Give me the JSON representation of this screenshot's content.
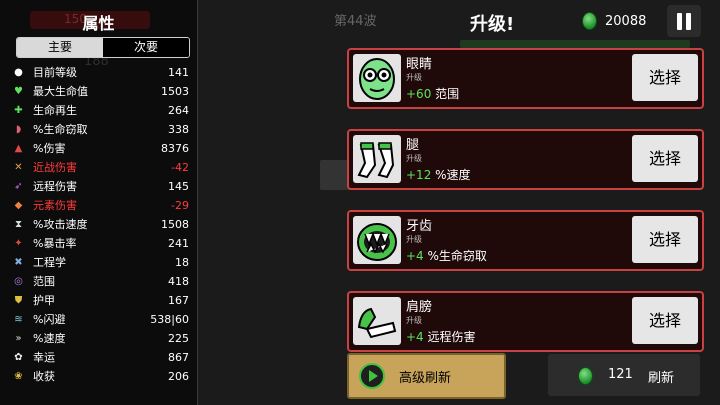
{
  "left_panel": {
    "ghost_hp": "150",
    "title": "属性",
    "ghost_number": "188",
    "tabs": [
      {
        "label": "主要",
        "active": true
      },
      {
        "label": "次要",
        "active": false
      }
    ],
    "stats": [
      {
        "icon": "level-icon",
        "color": "#ffffff",
        "label": "目前等级",
        "value": "141",
        "negative": false
      },
      {
        "icon": "heart-icon",
        "color": "#5ee15e",
        "label": "最大生命值",
        "value": "1503",
        "negative": false
      },
      {
        "icon": "regen-icon",
        "color": "#5ee15e",
        "label": "生命再生",
        "value": "264",
        "negative": false
      },
      {
        "icon": "lifesteal-icon",
        "color": "#e0607a",
        "label": "%生命窃取",
        "value": "338",
        "negative": false
      },
      {
        "icon": "damage-icon",
        "color": "#e04848",
        "label": "%伤害",
        "value": "8376",
        "negative": false
      },
      {
        "icon": "melee-icon",
        "color": "#e0a050",
        "label": "近战伤害",
        "value": "-42",
        "negative": true
      },
      {
        "icon": "ranged-icon",
        "color": "#c070e0",
        "label": "远程伤害",
        "value": "145",
        "negative": false
      },
      {
        "icon": "elemental-icon",
        "color": "#f08040",
        "label": "元素伤害",
        "value": "-29",
        "negative": true
      },
      {
        "icon": "attack-speed-icon",
        "color": "#dddddd",
        "label": "%攻击速度",
        "value": "1508",
        "negative": false
      },
      {
        "icon": "crit-icon",
        "color": "#e04848",
        "label": "%暴击率",
        "value": "241",
        "negative": false
      },
      {
        "icon": "engineering-icon",
        "color": "#80b0e0",
        "label": "工程学",
        "value": "18",
        "negative": false
      },
      {
        "icon": "range-icon",
        "color": "#b080e0",
        "label": "范围",
        "value": "418",
        "negative": false
      },
      {
        "icon": "armor-icon",
        "color": "#e0c040",
        "label": "护甲",
        "value": "167",
        "negative": false
      },
      {
        "icon": "dodge-icon",
        "color": "#80d0e0",
        "label": "%闪避",
        "value": "538|60",
        "negative": false
      },
      {
        "icon": "speed-icon",
        "color": "#dddddd",
        "label": "%速度",
        "value": "225",
        "negative": false
      },
      {
        "icon": "luck-icon",
        "color": "#eeeeee",
        "label": "幸运",
        "value": "867",
        "negative": false
      },
      {
        "icon": "harvest-icon",
        "color": "#e0c040",
        "label": "收获",
        "value": "206",
        "negative": false
      }
    ]
  },
  "header": {
    "wave": "第44波",
    "title": "升级!",
    "currency_amount": "20088",
    "currency_icon": "green-material-icon",
    "pause_icon": "pause-icon"
  },
  "upgrades": [
    {
      "name": "眼睛",
      "sub": "升级",
      "effect_value": "+60",
      "effect_label": "范围",
      "button": "选择",
      "icon": "alien-eyes-icon"
    },
    {
      "name": "腿",
      "sub": "升级",
      "effect_value": "+12",
      "effect_label": "%速度",
      "button": "选择",
      "icon": "legs-icon"
    },
    {
      "name": "牙齿",
      "sub": "升级",
      "effect_value": "+4",
      "effect_label": "%生命窃取",
      "button": "选择",
      "icon": "teeth-icon"
    },
    {
      "name": "肩膀",
      "sub": "升级",
      "effect_value": "+4",
      "effect_label": "远程伤害",
      "button": "选择",
      "icon": "shoulders-icon"
    }
  ],
  "footer": {
    "advanced_refresh": "高级刷新",
    "refresh_cost": "121",
    "refresh_label": "刷新"
  },
  "colors": {
    "card_border": "#c94141",
    "card_bg": "#200909",
    "positive": "#5ee15e",
    "negative": "#ff3b3b",
    "advanced_refresh_bg": "#c8a45a"
  }
}
